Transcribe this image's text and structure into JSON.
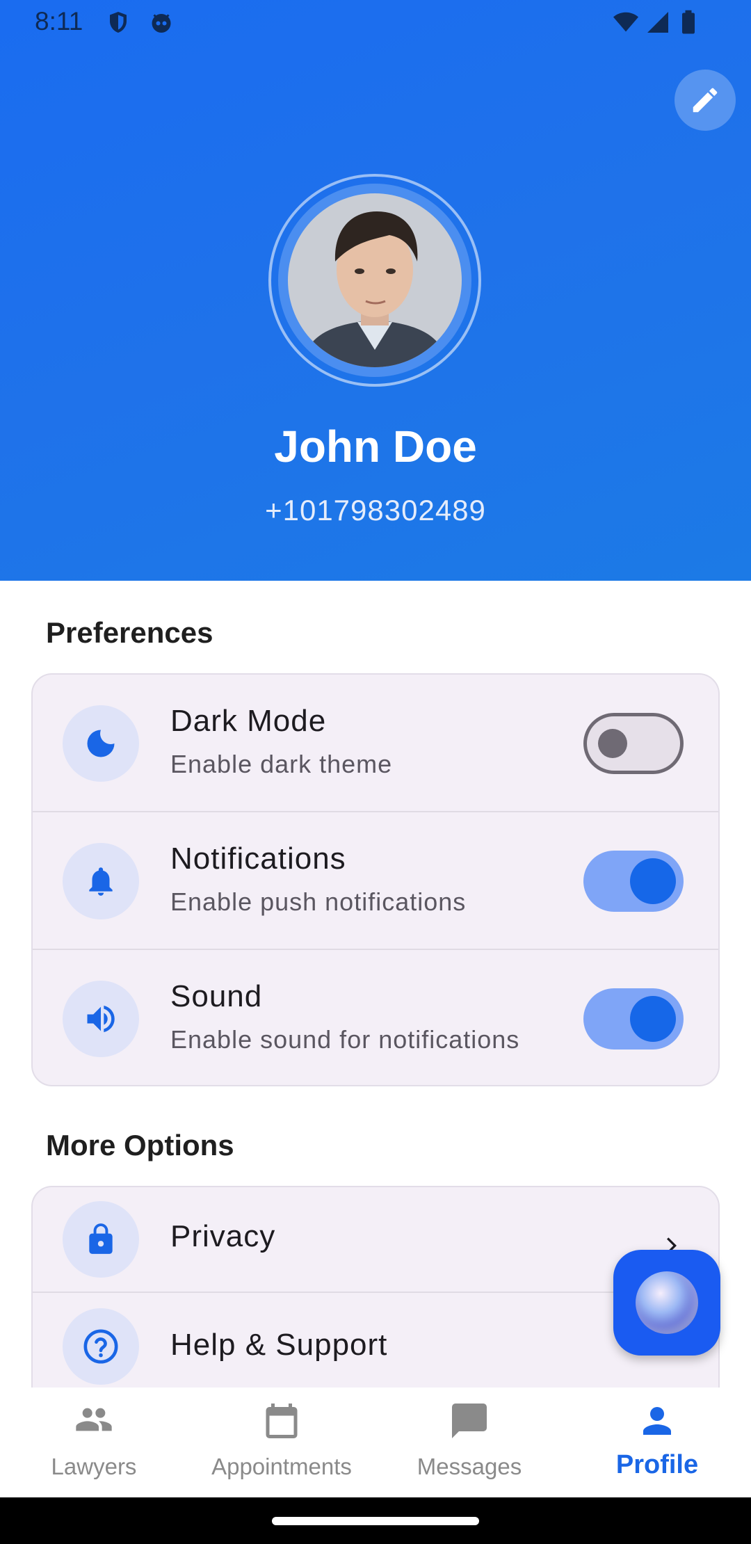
{
  "status_bar": {
    "time": "8:11"
  },
  "profile": {
    "name": "John Doe",
    "phone": "+101798302489"
  },
  "preferences": {
    "title": "Preferences",
    "items": [
      {
        "title": "Dark Mode",
        "subtitle": "Enable dark theme",
        "enabled": false,
        "icon": "moon-icon"
      },
      {
        "title": "Notifications",
        "subtitle": "Enable push notifications",
        "enabled": true,
        "icon": "bell-icon"
      },
      {
        "title": "Sound",
        "subtitle": "Enable sound for notifications",
        "enabled": true,
        "icon": "speaker-icon"
      }
    ]
  },
  "more_options": {
    "title": "More Options",
    "items": [
      {
        "title": "Privacy",
        "icon": "lock-icon"
      },
      {
        "title": "Help & Support",
        "icon": "help-icon"
      }
    ]
  },
  "bottom_nav": {
    "items": [
      {
        "label": "Lawyers",
        "icon": "people-icon",
        "active": false
      },
      {
        "label": "Appointments",
        "icon": "calendar-icon",
        "active": false
      },
      {
        "label": "Messages",
        "icon": "chat-icon",
        "active": false
      },
      {
        "label": "Profile",
        "icon": "person-icon",
        "active": true
      }
    ]
  },
  "colors": {
    "primary": "#1a6cf0",
    "accent": "#1667e8",
    "card_bg": "#f4eff7"
  }
}
